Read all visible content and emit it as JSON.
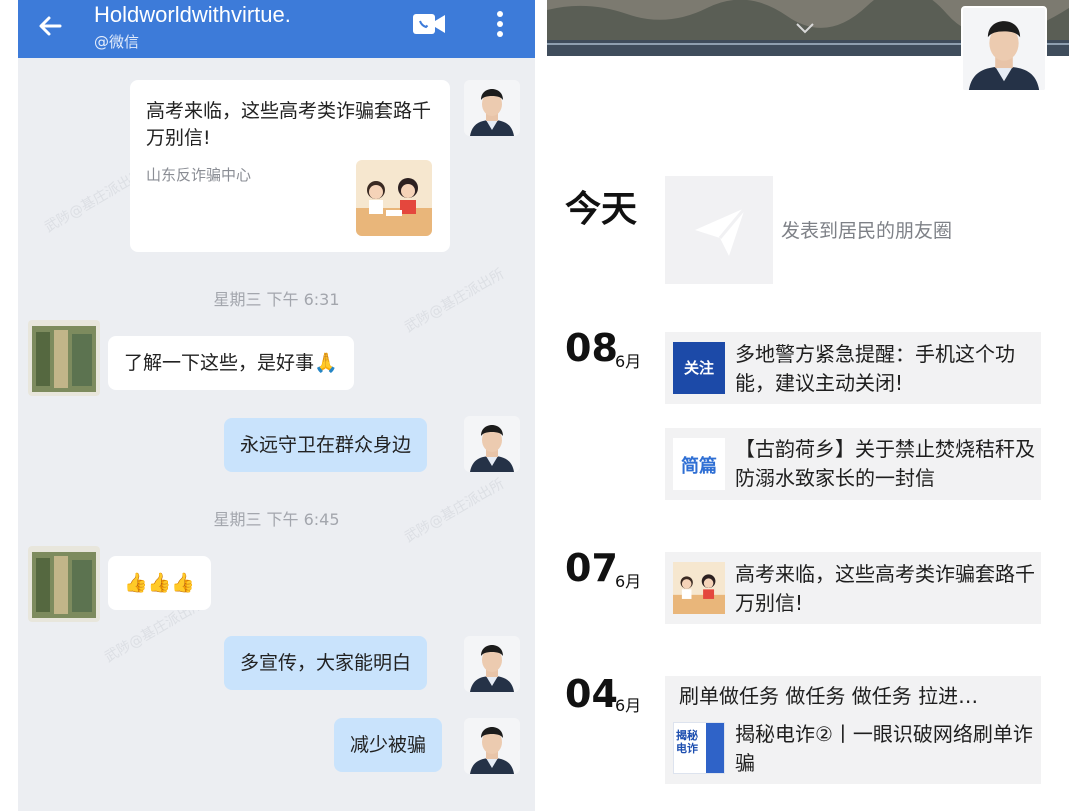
{
  "chat": {
    "title": "Holdworldwithvirtue.",
    "subtitle": "@微信",
    "card": {
      "title": "高考来临，这些高考类诈骗套路千万别信!",
      "source": "山东反诈骗中心"
    },
    "messages": [
      {
        "time": "星期三  下午 6:31"
      },
      {
        "from": "contact",
        "text": "了解一下这些，是好事🙏"
      },
      {
        "from": "me",
        "text": "永远守卫在群众身边"
      },
      {
        "time": "星期三  下午 6:45"
      },
      {
        "from": "contact",
        "text": "👍👍👍"
      },
      {
        "from": "me",
        "text": "多宣传，大家能明白"
      },
      {
        "from": "me",
        "text": "减少被骗"
      }
    ],
    "watermark": "武陟@基庄派出所"
  },
  "moments": {
    "today_label": "今天",
    "post_hint": "发表到居民的朋友圈",
    "entries": [
      {
        "day": "08",
        "month": "6月",
        "badge": "关注",
        "text": "多地警方紧急提醒：手机这个功能，建议主动关闭!"
      },
      {
        "day": "",
        "month": "",
        "badge": "简篇",
        "text": "【古韵荷乡】关于禁止焚烧秸秆及防溺水致家长的一封信"
      },
      {
        "day": "07",
        "month": "6月",
        "badge": "",
        "text": "高考来临，这些高考类诈骗套路千万别信!"
      },
      {
        "day": "04",
        "month": "6月",
        "badge": "",
        "text": "刷单做任务 做任务 做任务 拉进…"
      },
      {
        "day": "",
        "month": "",
        "badge": "揭秘电诈",
        "text": "揭秘电诈②丨一眼识破网络刷单诈骗"
      }
    ]
  },
  "colors": {
    "topbar": "#3d7bd9",
    "bubble_me": "#c9e3fc",
    "chat_bg": "#eceef2"
  }
}
